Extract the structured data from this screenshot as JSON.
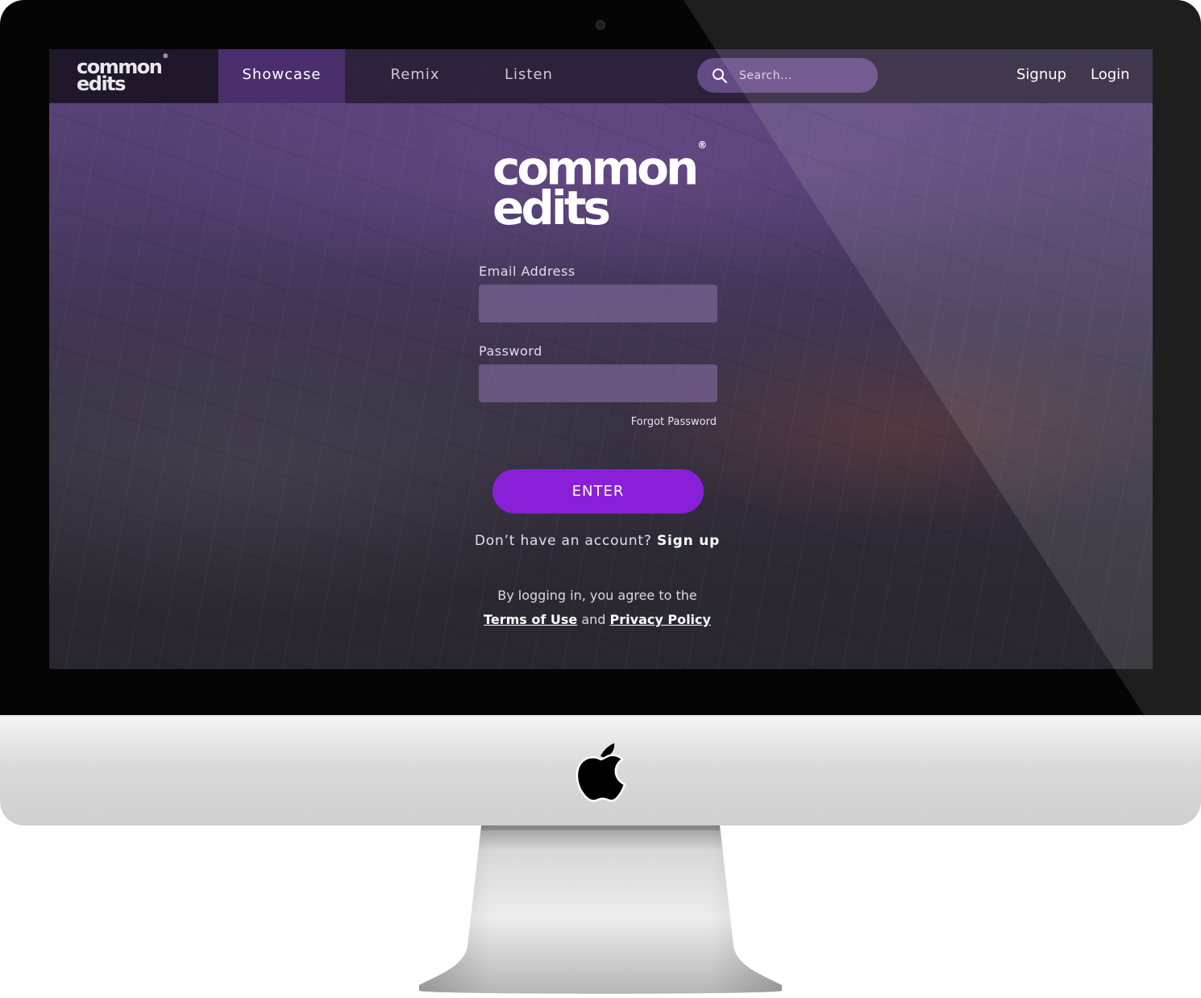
{
  "nav": {
    "logo_line1": "common",
    "logo_line2": "edits",
    "logo_mark": "®",
    "tabs": [
      {
        "label": "Showcase",
        "active": true
      },
      {
        "label": "Remix",
        "active": false
      },
      {
        "label": "Listen",
        "active": false
      }
    ],
    "search_placeholder": "Search...",
    "search_icon": "search-icon",
    "signup_label": "Signup",
    "login_label": "Login"
  },
  "login": {
    "brand_line1": "common",
    "brand_line2": "edits",
    "brand_mark": "®",
    "email_label": "Email Address",
    "email_value": "",
    "password_label": "Password",
    "password_value": "",
    "forgot_label": "Forgot Password",
    "enter_label": "ENTER",
    "no_account_text": "Don’t have an account?",
    "signup_link": "Sign up",
    "legal_text": "By logging in, you agree to the",
    "terms_link": "Terms of Use",
    "and_text": "and",
    "privacy_link": "Privacy Policy"
  },
  "colors": {
    "accent": "#8a1fd9",
    "active_tab": "#4b2f6d",
    "navbar": "#261e32"
  }
}
